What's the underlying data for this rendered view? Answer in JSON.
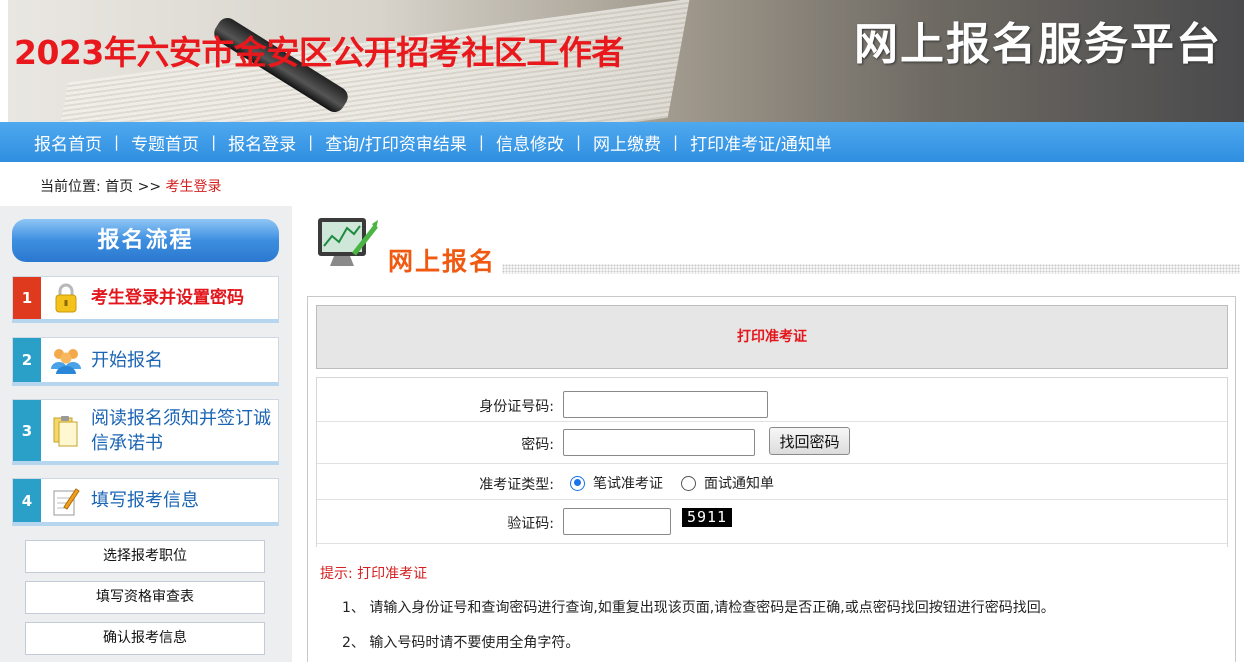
{
  "banner": {
    "title_left": "2023年六安市金安区公开招考社区工作者",
    "title_right": "网上报名服务平台"
  },
  "nav": {
    "items": [
      "报名首页",
      "专题首页",
      "报名登录",
      "查询/打印资审结果",
      "信息修改",
      "网上缴费",
      "打印准考证/通知单"
    ],
    "separator": "|"
  },
  "breadcrumb": {
    "label": "当前位置:",
    "home": "首页",
    "arrow": ">>",
    "current": "考生登录"
  },
  "sidebar": {
    "title": "报名流程",
    "steps": [
      {
        "num": "1",
        "label": "考生登录并设置密码",
        "icon": "lock-icon"
      },
      {
        "num": "2",
        "label": "开始报名",
        "icon": "users-icon"
      },
      {
        "num": "3",
        "label": "阅读报名须知并签订诚信承诺书",
        "icon": "document-icon"
      },
      {
        "num": "4",
        "label": "填写报考信息",
        "icon": "edit-icon"
      }
    ],
    "sub_buttons": [
      "选择报考职位",
      "填写资格审查表",
      "确认报考信息"
    ]
  },
  "main": {
    "heading": "网上报名",
    "panel_title": "打印准考证",
    "form": {
      "id_label": "身份证号码:",
      "password_label": "密码:",
      "find_password_button": "找回密码",
      "type_label": "准考证类型:",
      "type_options": [
        "笔试准考证",
        "面试通知单"
      ],
      "type_selected": "笔试准考证",
      "captcha_label": "验证码:",
      "captcha_code": "5911"
    },
    "tips": {
      "title": "提示:  打印准考证",
      "lines": [
        "1、 请输入身份证号和查询密码进行查询,如重复出现该页面,请检查密码是否正确,或点密码找回按钮进行密码找回。",
        "2、 输入号码时请不要使用全角字符。"
      ]
    }
  },
  "colors": {
    "nav_bg": "#2f8ee0",
    "accent_red": "#e3161c",
    "heading_orange": "#f0590f",
    "step_active": "#e03a1e",
    "step_num": "#2aa0c8"
  }
}
